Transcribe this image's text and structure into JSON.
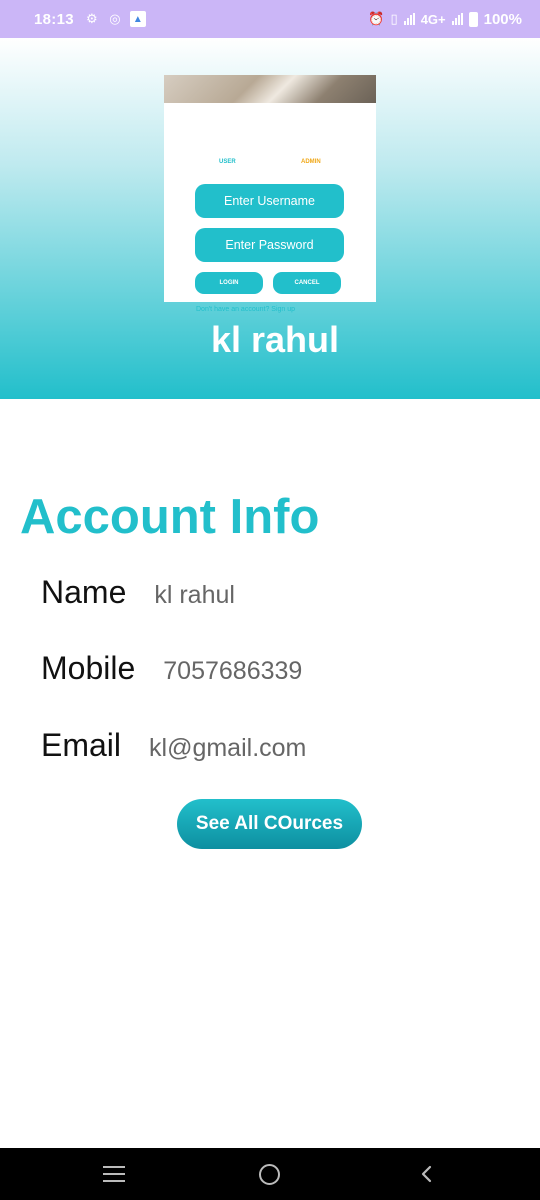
{
  "status_bar": {
    "time": "18:13",
    "network": "4G+",
    "battery": "100%"
  },
  "header": {
    "preview": {
      "tab_user": "USER",
      "tab_admin": "ADMIN",
      "username_placeholder": "Enter Username",
      "password_placeholder": "Enter Password",
      "login_label": "LOGIN",
      "cancel_label": "CANCEL",
      "signup_link": "Don't have an account? Sign up"
    },
    "user_name": "kl rahul"
  },
  "account": {
    "title": "Account Info",
    "name_label": "Name",
    "name_value": "kl rahul",
    "mobile_label": "Mobile",
    "mobile_value": "7057686339",
    "email_label": "Email",
    "email_value": "kl@gmail.com"
  },
  "actions": {
    "see_courses_label": "See All COurces"
  },
  "nav": {
    "icons": [
      "menu-icon",
      "home-icon",
      "back-icon"
    ]
  },
  "colors": {
    "accent": "#22bfcb",
    "status_bar": "#cbb6f7",
    "admin_tab": "#f0a818"
  }
}
